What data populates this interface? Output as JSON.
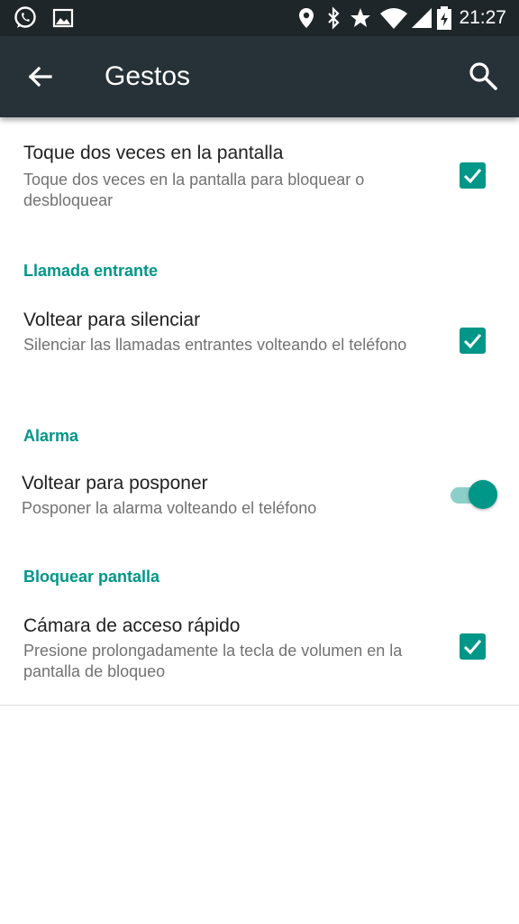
{
  "statusbar": {
    "time": "21:27",
    "icons": [
      "whatsapp-icon",
      "image-icon",
      "location-icon",
      "bluetooth-icon",
      "star-icon",
      "wifi-icon",
      "signal-icon",
      "battery-charging-icon"
    ]
  },
  "appbar": {
    "title": "Gestos",
    "back_icon": "arrow-back-icon",
    "search_icon": "search-icon"
  },
  "colors": {
    "accent": "#009688",
    "appbar": "#263238",
    "statusbar": "#1f2629"
  },
  "preferences": [
    {
      "title": "Toque dos veces en la pantalla",
      "summary": "Toque dos veces en la pantalla para bloquear o desbloquear",
      "control": "checkbox",
      "checked": true
    },
    {
      "category": "Llamada entrante",
      "title": "Voltear para silenciar",
      "summary": "Silenciar las llamadas entrantes volteando el teléfono",
      "control": "checkbox",
      "checked": true
    },
    {
      "category": "Alarma",
      "title": "Voltear para posponer",
      "summary": "Posponer la alarma volteando el teléfono",
      "control": "switch",
      "checked": true
    },
    {
      "category": "Bloquear pantalla",
      "title": "Cámara de acceso rápido",
      "summary": "Presione prolongadamente la tecla de volumen en la pantalla de bloqueo",
      "control": "checkbox",
      "checked": true
    }
  ]
}
